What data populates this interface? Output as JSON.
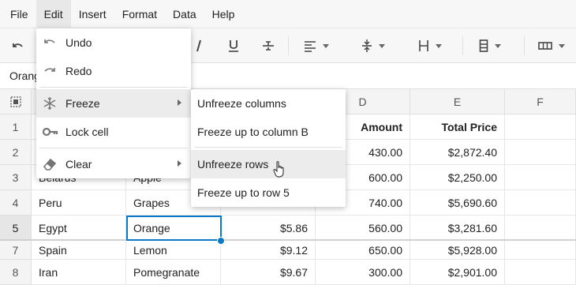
{
  "menubar": {
    "items": [
      "File",
      "Edit",
      "Insert",
      "Format",
      "Data",
      "Help"
    ],
    "active": "Edit"
  },
  "toolbar": {
    "icons": [
      "undo-icon",
      "italic-icon",
      "underline-icon",
      "strikethrough-icon",
      "align-left-icon",
      "vertical-align-icon",
      "text-height-icon",
      "column-icon",
      "border-icon"
    ]
  },
  "formula": {
    "value": "Orange"
  },
  "columns": [
    "D",
    "E",
    "F"
  ],
  "rows": [
    {
      "num": "1",
      "a": "",
      "b": "",
      "c": "",
      "d": "Amount",
      "e": "Total Price"
    },
    {
      "num": "2",
      "a": "",
      "b": "",
      "c": "",
      "d": "430.00",
      "e": "$2,872.40"
    },
    {
      "num": "3",
      "a": "Belarus",
      "b": "Apple",
      "c": "",
      "d": "600.00",
      "e": "$2,250.00"
    },
    {
      "num": "4",
      "a": "Peru",
      "b": "Grapes",
      "c": "",
      "d": "740.00",
      "e": "$5,690.60"
    },
    {
      "num": "5",
      "a": "Egypt",
      "b": "Orange",
      "c": "$5.86",
      "d": "560.00",
      "e": "$3,281.60"
    },
    {
      "num": "7",
      "a": "Spain",
      "b": "Lemon",
      "c": "$9.12",
      "d": "650.00",
      "e": "$5,928.00"
    },
    {
      "num": "8",
      "a": "Iran",
      "b": "Pomegranate",
      "c": "$9.67",
      "d": "300.00",
      "e": "$2,901.00"
    }
  ],
  "edit_menu": {
    "items": [
      {
        "label": "Undo",
        "icon": "undo-icon"
      },
      {
        "label": "Redo",
        "icon": "redo-icon"
      },
      {
        "label": "Freeze",
        "icon": "snowflake-icon"
      },
      {
        "label": "Lock cell",
        "icon": "key-icon"
      },
      {
        "label": "Clear",
        "icon": "eraser-icon"
      }
    ]
  },
  "freeze_submenu": {
    "items": [
      "Unfreeze columns",
      "Freeze up to column B",
      "Unfreeze rows",
      "Freeze up to row 5"
    ]
  },
  "colors": {
    "accent": "#0a7ac6",
    "menubar_bg": "#f7f7f7",
    "header_bg": "#f4f4f4",
    "hover_bg": "#ececec"
  }
}
